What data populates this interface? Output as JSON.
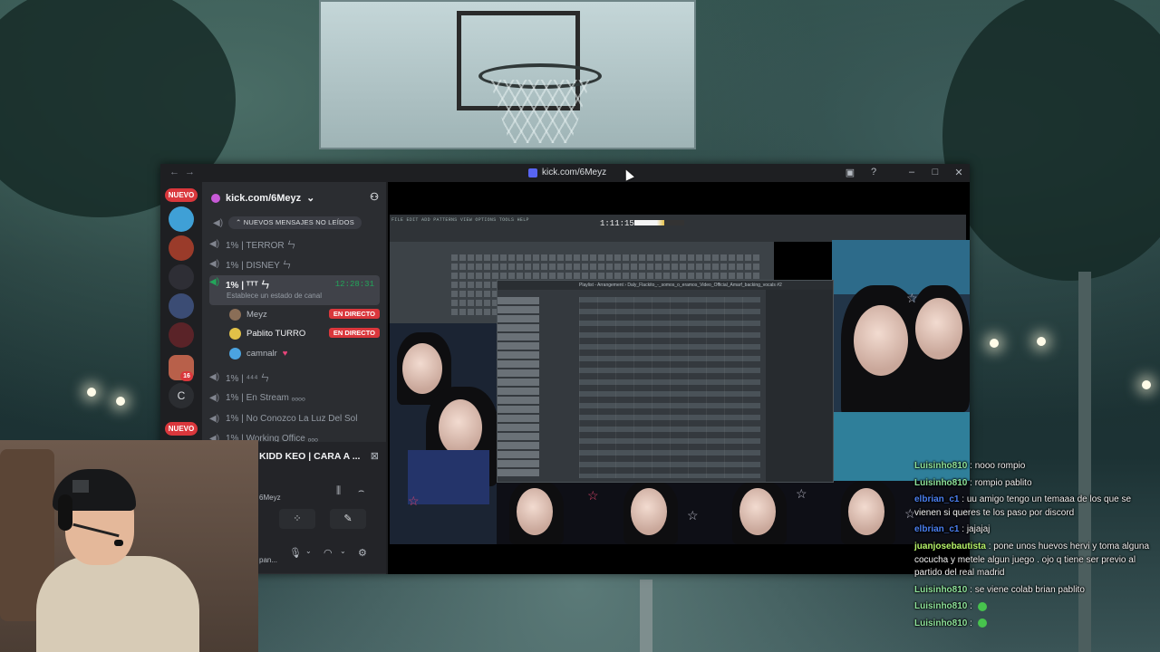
{
  "window": {
    "title": "kick.com/6Meyz",
    "nav_back": "←",
    "nav_forward": "→"
  },
  "rail": {
    "new_badge_top": "NUEVO",
    "new_badge_bottom": "NUEVO",
    "mention_count": "16",
    "letter_server": "C"
  },
  "server": {
    "name": "kick.com/6Meyz",
    "new_messages": "NUEVOS MENSAJES NO LEÍDOS"
  },
  "channels": [
    {
      "label": "1% | TERROR ㄣ"
    },
    {
      "label": "1% | DISNEY ㄣ"
    },
    {
      "label": "1% | ᵀᵀᵀ ㄣ",
      "time": "12:28:31",
      "status": "Establece un estado de canal"
    },
    {
      "label": "1% | ⁴⁴⁴ ㄣ"
    },
    {
      "label": "1% | En Stream ₒₒₒₒ"
    },
    {
      "label": "1% | No Conozco La Luz Del Sol"
    },
    {
      "label": "1% | Working Office ₒₒₒ"
    }
  ],
  "voice_users": [
    {
      "name": "Meyz",
      "live": "EN DIRECTO"
    },
    {
      "name": "Pablito TURRO",
      "live": "EN DIRECTO"
    },
    {
      "name": "camnalr"
    }
  ],
  "voice_panel": {
    "title": "KIDD KEO | CARA A ...",
    "subtitle": "6Meyz",
    "user_status": "pan..."
  },
  "daw": {
    "menu": "FILE EDIT ADD PATTERNS VIEW OPTIONS TOOLS HELP",
    "time": "1:11:15",
    "playlist_title": "Playlist - Arrangement › Daly_Flackito_-_somos_o_eramos_Video_Official_Amarf_backing_vocals #2"
  },
  "chat": [
    {
      "user": "Luisinho810",
      "text": ": nooo rompio",
      "color": "#8ee39b"
    },
    {
      "user": "Luisinho810",
      "text": ": rompio pablito",
      "color": "#8ee39b"
    },
    {
      "user": "elbrian_c1",
      "text": ": uu amigo tengo un temaaa de los que se vienen si queres te los paso por discord",
      "color": "#4a7ff0"
    },
    {
      "user": "elbrian_c1",
      "text": ": jajajaj",
      "color": "#4a7ff0"
    },
    {
      "user": "juanjosebautista",
      "text": ": pone unos huevos hervi y toma alguna cocucha y metele algun juego . ojo q tiene ser previo al partido del real madrid",
      "color": "#b6f36a"
    },
    {
      "user": "Luisinho810",
      "text": ": se viene colab brian pablito",
      "color": "#8ee39b"
    },
    {
      "user": "Luisinho810",
      "text": ":",
      "color": "#8ee39b",
      "emoji": true
    },
    {
      "user": "Luisinho810",
      "text": ":",
      "color": "#8ee39b",
      "emoji": true
    }
  ],
  "colors": {
    "accent_live": "#da373c",
    "voice_green": "#23a55a",
    "discord_bg": "#2b2d31"
  }
}
